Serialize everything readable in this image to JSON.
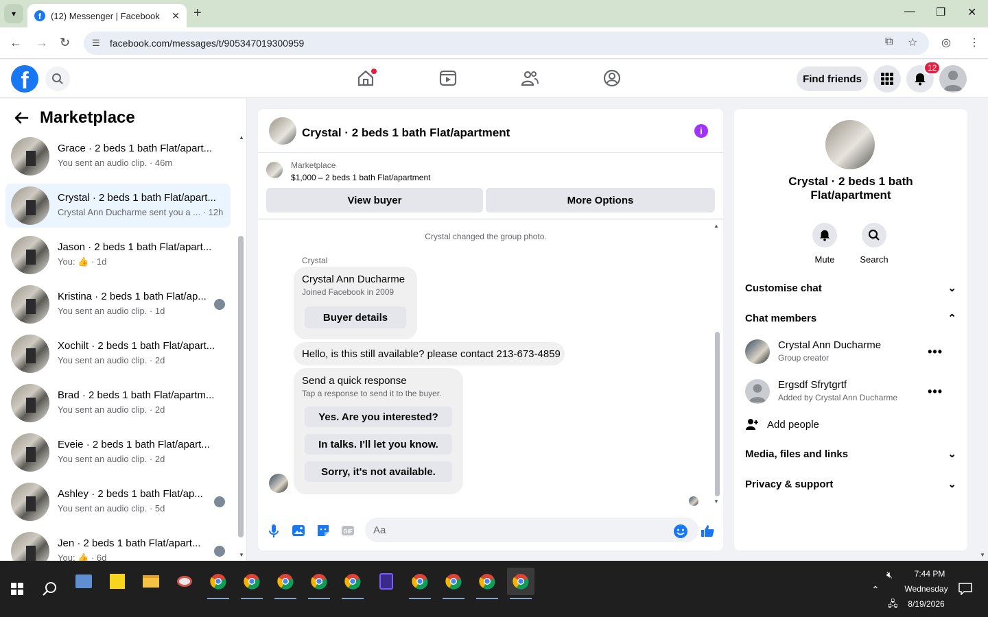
{
  "browser": {
    "tab_title": "(12) Messenger | Facebook",
    "url": "facebook.com/messages/t/905347019300959"
  },
  "topbar": {
    "find_friends": "Find friends",
    "notification_count": "12"
  },
  "left": {
    "title": "Marketplace",
    "conversations": [
      {
        "name": "Grace · 2 beds 1 bath Flat/apart...",
        "preview": "You sent an audio clip. · 46m",
        "mini": false
      },
      {
        "name": "Crystal · 2 beds 1 bath Flat/apart...",
        "preview": "Crystal Ann Ducharme sent you a ... · 12h",
        "mini": false
      },
      {
        "name": "Jason · 2 beds 1 bath Flat/apart...",
        "preview": "You: 👍 · 1d",
        "mini": false
      },
      {
        "name": "Kristina · 2 beds 1 bath Flat/ap...",
        "preview": "You sent an audio clip. · 1d",
        "mini": true
      },
      {
        "name": "Xochilt · 2 beds 1 bath Flat/apart...",
        "preview": "You sent an audio clip. · 2d",
        "mini": false
      },
      {
        "name": "Brad · 2 beds 1 bath Flat/apartm...",
        "preview": "You sent an audio clip. · 2d",
        "mini": false
      },
      {
        "name": "Eveie · 2 beds 1 bath Flat/apart...",
        "preview": "You sent an audio clip. · 2d",
        "mini": false
      },
      {
        "name": "Ashley · 2 beds 1 bath Flat/ap...",
        "preview": "You sent an audio clip. · 5d",
        "mini": true
      },
      {
        "name": "Jen · 2 beds 1 bath Flat/apart...",
        "preview": "You: 👍 · 6d",
        "mini": true
      }
    ]
  },
  "chat": {
    "title": "Crystal · 2 beds 1 bath Flat/apartment",
    "marketplace_label": "Marketplace",
    "listing": "$1,000 – 2 beds 1 bath Flat/apartment",
    "view_buyer": "View buyer",
    "more_options": "More Options",
    "system_message": "Crystal changed the group photo.",
    "sender": "Crystal",
    "profile_name": "Crystal Ann Ducharme",
    "profile_sub": "Joined Facebook in 2009",
    "buyer_details": "Buyer details",
    "message": "Hello, is this still available? please contact 213-673-4859",
    "quick_title": "Send a quick response",
    "quick_sub": "Tap a response to send it to the buyer.",
    "quick_1": "Yes. Are you interested?",
    "quick_2": "In talks. I'll let you know.",
    "quick_3": "Sorry, it's not available.",
    "composer_placeholder": "Aa"
  },
  "right": {
    "title": "Crystal · 2 beds 1 bath Flat/apartment",
    "mute": "Mute",
    "search": "Search",
    "customise": "Customise chat",
    "members_label": "Chat members",
    "member1_name": "Crystal Ann Ducharme",
    "member1_sub": "Group creator",
    "member2_name": "Ergsdf Sfrytgrtf",
    "member2_sub": "Added by Crystal Ann Ducharme",
    "add_people": "Add people",
    "media": "Media, files and links",
    "privacy": "Privacy & support"
  },
  "taskbar": {
    "time": "7:44 PM",
    "day": "Wednesday",
    "date": "8/19/2026"
  },
  "colors": {
    "fb_blue": "#1877f2",
    "info_purple": "#a033ff",
    "active_row": "#ebf5ff"
  }
}
